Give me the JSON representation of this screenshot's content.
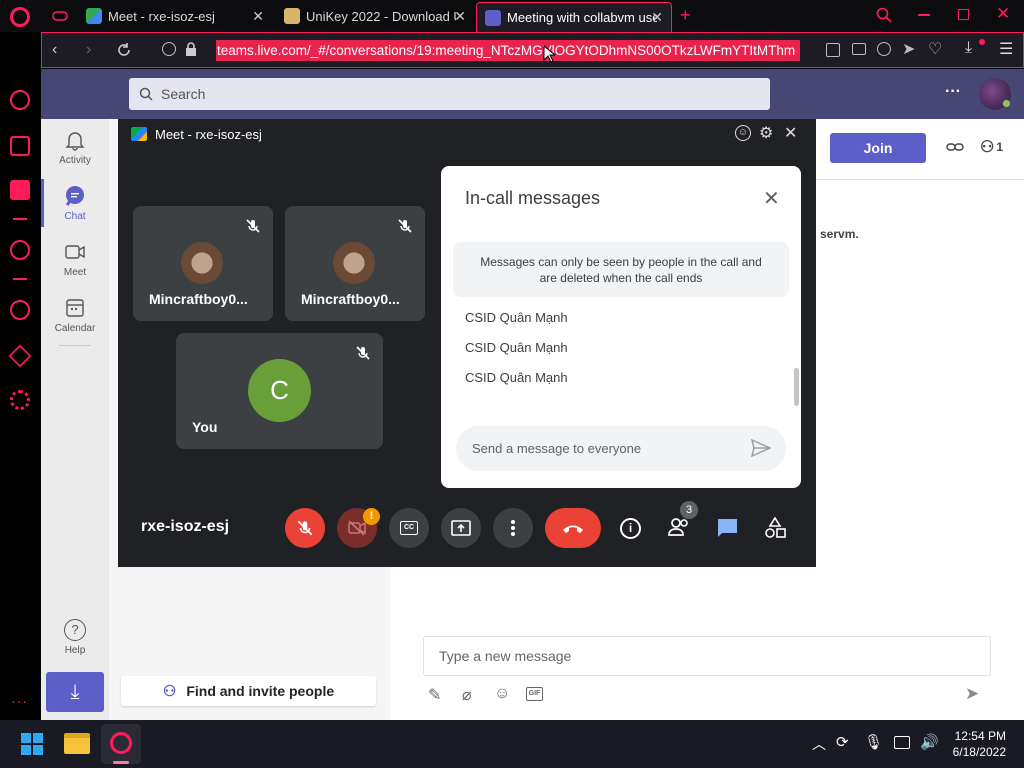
{
  "browser": {
    "tabs": [
      {
        "label": "Meet - rxe-isoz-esj",
        "active": false
      },
      {
        "label": "UniKey 2022 - Download U",
        "active": false
      },
      {
        "label": "Meeting with collabvm use",
        "active": true
      }
    ],
    "new_tab": "+",
    "url": "teams.live.com/_#/conversations/19:meeting_NTczMGVlOGYtODhmNS00OTkzLWFmYTItMThm"
  },
  "teams": {
    "search_placeholder": "Search",
    "more": "···",
    "rail": [
      {
        "label": "Activity",
        "icon": "bell-icon"
      },
      {
        "label": "Chat",
        "icon": "chat-icon",
        "active": true
      },
      {
        "label": "Meet",
        "icon": "video-icon"
      },
      {
        "label": "Calendar",
        "icon": "calendar-icon"
      }
    ],
    "help_label": "Help",
    "find_invite": "Find and invite people",
    "join_label": "Join",
    "participants_count": "1",
    "partial_text": "servm.",
    "compose_placeholder": "Type a new message",
    "gif_label": "GIF"
  },
  "meet": {
    "window_title": "Meet - rxe-isoz-esj",
    "tiles": [
      {
        "name": "Mincraftboy0..."
      },
      {
        "name": "Mincraftboy0..."
      },
      {
        "name": "You",
        "initial": "C"
      }
    ],
    "meeting_code": "rxe-isoz-esj",
    "camera_alert": "!",
    "people_badge": "3",
    "panel": {
      "title": "In-call messages",
      "notice": "Messages can only be seen by people in the call and are deleted when the call ends",
      "messages": [
        "CSID Quân Mạnh",
        "CSID Quân Mạnh",
        "CSID Quân Mạnh"
      ],
      "input_placeholder": "Send a message to everyone"
    }
  },
  "taskbar": {
    "time": "12:54 PM",
    "date": "6/18/2022"
  },
  "colors": {
    "opera_red": "#ff1b5a",
    "teams_purple": "#464775",
    "join": "#5b5fc7",
    "meet_bg": "#202124",
    "end_call": "#ea4335",
    "avatar_green": "#689f38",
    "chat_blue": "#8ab4f8"
  }
}
